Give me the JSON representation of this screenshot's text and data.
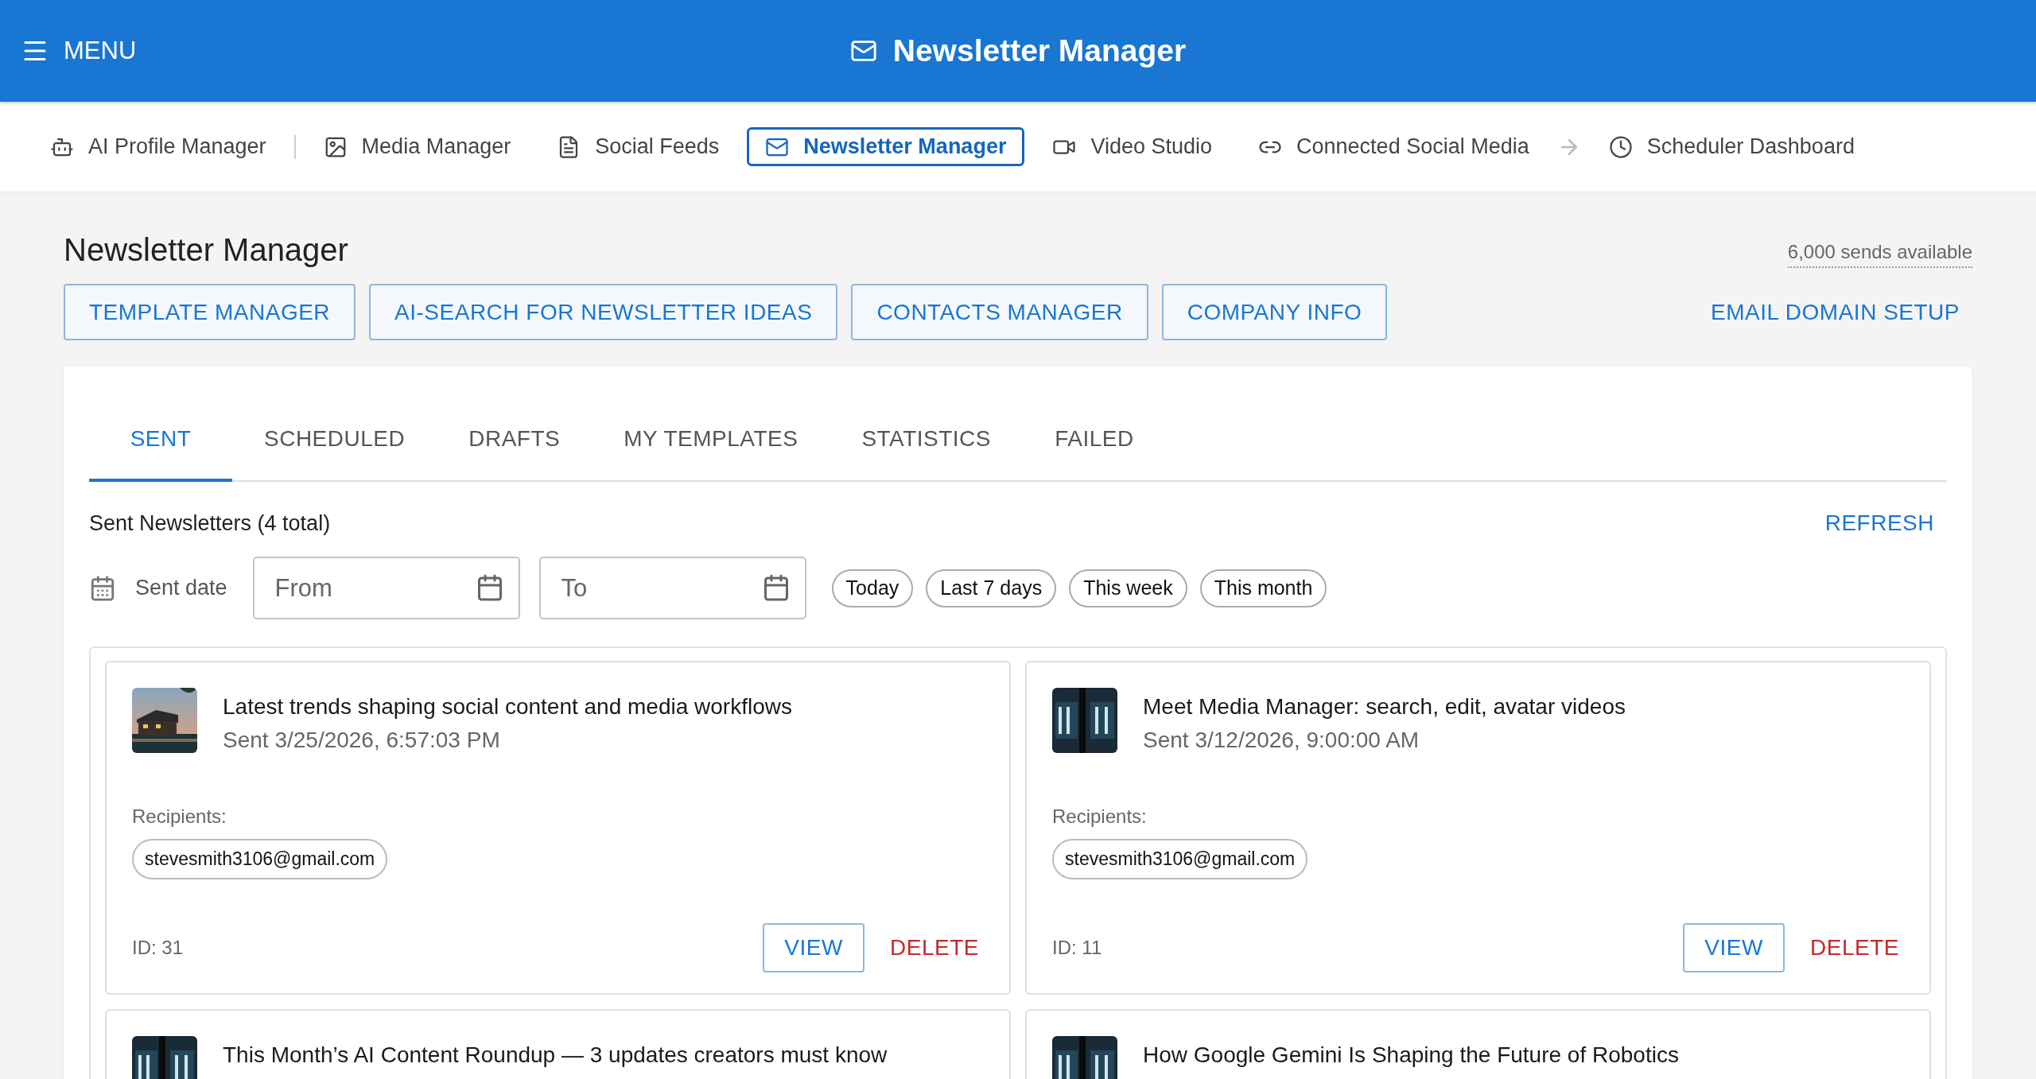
{
  "app_bar": {
    "menu_label": "MENU",
    "title": "Newsletter Manager"
  },
  "nav": [
    {
      "label": "AI Profile Manager",
      "selected": false
    },
    {
      "label": "Media Manager",
      "selected": false
    },
    {
      "label": "Social Feeds",
      "selected": false
    },
    {
      "label": "Newsletter Manager",
      "selected": true
    },
    {
      "label": "Video Studio",
      "selected": false
    },
    {
      "label": "Connected Social Media",
      "selected": false
    },
    {
      "label": "Scheduler Dashboard",
      "selected": false
    }
  ],
  "page": {
    "title": "Newsletter Manager",
    "sends": "6,000 sends available"
  },
  "actions": [
    "TEMPLATE MANAGER",
    "AI-SEARCH FOR NEWSLETTER IDEAS",
    "CONTACTS MANAGER",
    "COMPANY INFO"
  ],
  "domain_link": "EMAIL DOMAIN SETUP",
  "tabs": [
    {
      "label": "SENT",
      "selected": true
    },
    {
      "label": "SCHEDULED",
      "selected": false
    },
    {
      "label": "DRAFTS",
      "selected": false
    },
    {
      "label": "MY TEMPLATES",
      "selected": false
    },
    {
      "label": "STATISTICS",
      "selected": false
    },
    {
      "label": "FAILED",
      "selected": false
    }
  ],
  "list": {
    "heading": "Sent Newsletters (4 total)",
    "refresh": "REFRESH"
  },
  "filter": {
    "label": "Sent date",
    "from": {
      "placeholder": "From"
    },
    "to": {
      "placeholder": "To"
    },
    "presets": [
      "Today",
      "Last 7 days",
      "This week",
      "This month"
    ]
  },
  "newsletters": [
    {
      "title": "Latest trends shaping social content and media workflows",
      "sent": "Sent 3/25/2026, 6:57:03 PM",
      "recipients_label": "Recipients:",
      "recipients": [
        "stevesmith3106@gmail.com"
      ],
      "id": "ID: 31",
      "view": "VIEW",
      "delete": "DELETE"
    },
    {
      "title": "Meet Media Manager: search, edit, avatar videos",
      "sent": "Sent 3/12/2026, 9:00:00 AM",
      "recipients_label": "Recipients:",
      "recipients": [
        "stevesmith3106@gmail.com"
      ],
      "id": "ID: 11",
      "view": "VIEW",
      "delete": "DELETE"
    },
    {
      "title": "This Month’s AI Content Roundup — 3 updates creators must know"
    },
    {
      "title": "How Google Gemini Is Shaping the Future of Robotics"
    }
  ]
}
